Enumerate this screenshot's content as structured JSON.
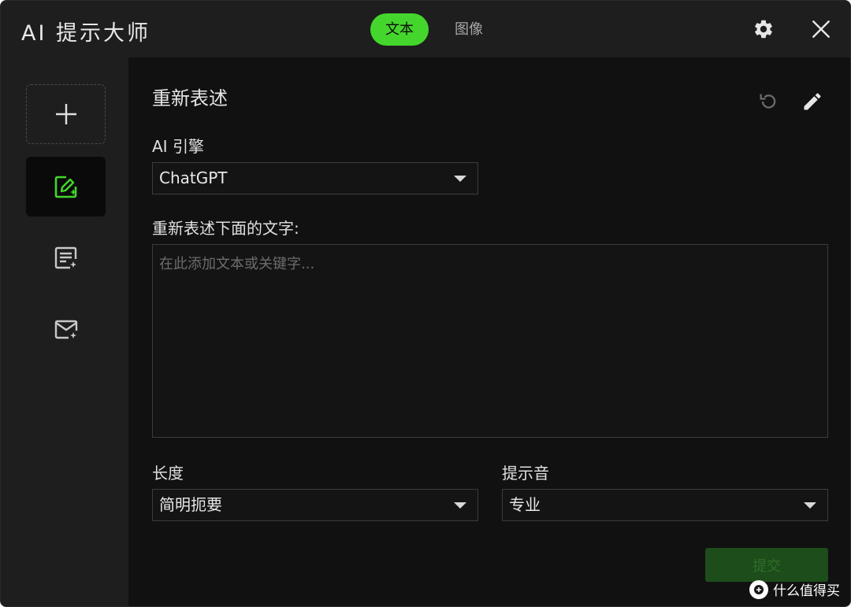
{
  "window": {
    "title": "AI 提示大师",
    "tabs": [
      {
        "label": "文本",
        "active": true
      },
      {
        "label": "图像",
        "active": false
      }
    ],
    "settings_icon": "gear-icon",
    "close_icon": "close-icon"
  },
  "sidebar": {
    "items": [
      {
        "icon": "plus-icon",
        "name": "add",
        "selected": false
      },
      {
        "icon": "edit-sparkle-icon",
        "name": "rephrase",
        "selected": true
      },
      {
        "icon": "document-sparkle-icon",
        "name": "summary",
        "selected": false
      },
      {
        "icon": "mail-sparkle-icon",
        "name": "email",
        "selected": false
      }
    ]
  },
  "main": {
    "section_title": "重新表述",
    "reset_icon": "reset-icon",
    "edit_icon": "pencil-icon",
    "engine": {
      "label": "AI 引擎",
      "value": "ChatGPT"
    },
    "input": {
      "label": "重新表述下面的文字:",
      "value": "",
      "placeholder": "在此添加文本或关键字..."
    },
    "length": {
      "label": "长度",
      "value": "简明扼要"
    },
    "tone": {
      "label": "提示音",
      "value": "专业"
    },
    "submit_label": "提交"
  },
  "watermark": {
    "text": "什么值得买"
  },
  "colors": {
    "accent": "#44d62c",
    "window_bg": "#111111",
    "panel_bg": "#1e1e1e",
    "submit_disabled_bg": "#1d4d1a"
  }
}
